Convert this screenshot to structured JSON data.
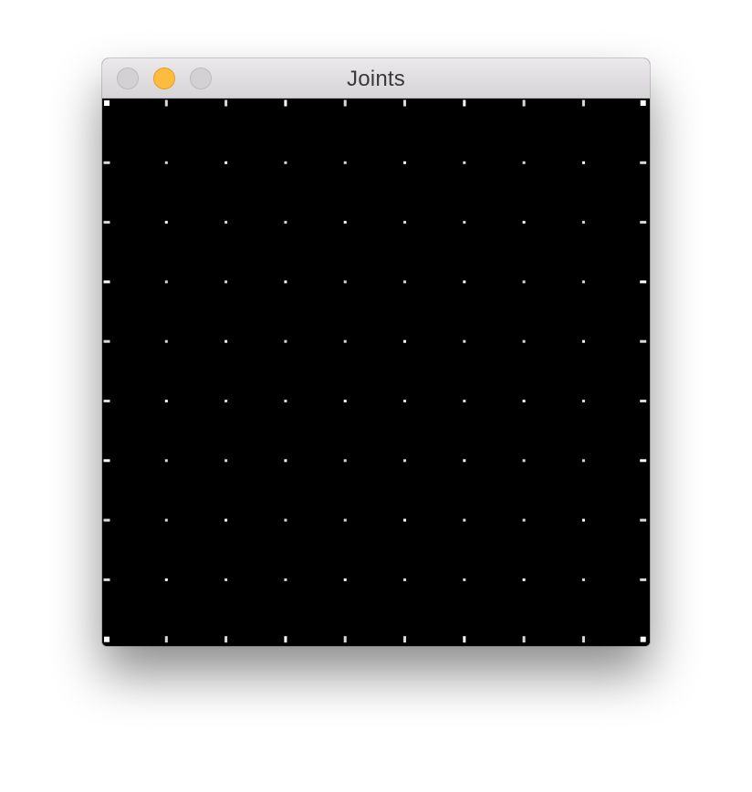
{
  "window": {
    "title": "Joints",
    "buttons": {
      "close": "close",
      "minimize": "minimize",
      "zoom": "zoom"
    }
  },
  "canvas": {
    "background": "#000000",
    "joint_color": "#ffffff",
    "grid": {
      "rows": 10,
      "columns": 10
    }
  }
}
